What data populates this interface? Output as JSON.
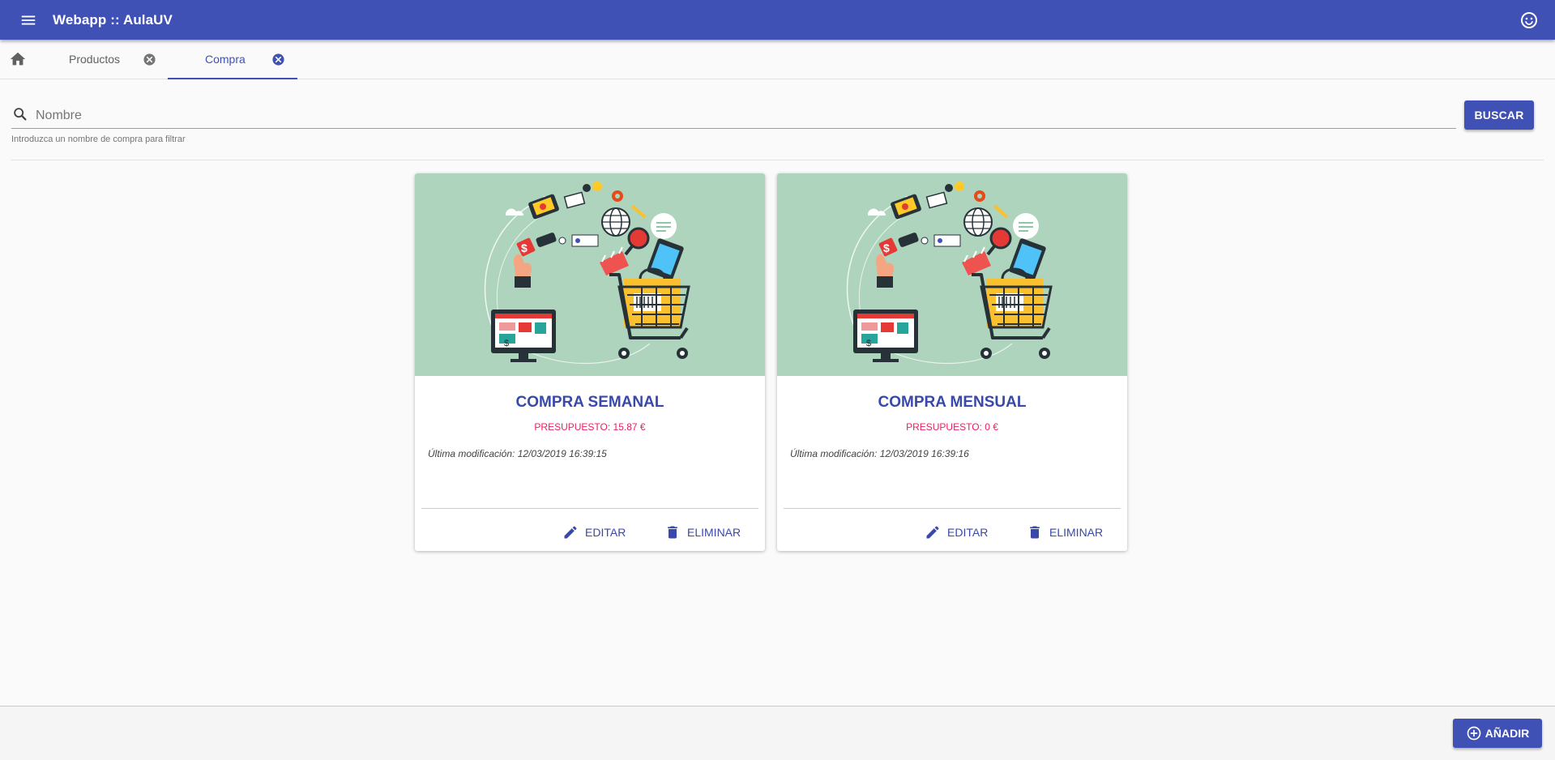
{
  "app": {
    "title": "Webapp :: AulaUV"
  },
  "tabs": [
    {
      "label": "Productos",
      "active": false
    },
    {
      "label": "Compra",
      "active": true
    }
  ],
  "search": {
    "placeholder": "Nombre",
    "value": "",
    "hint": "Introduzca un nombre de compra para filtrar",
    "button_label": "BUSCAR"
  },
  "cards": [
    {
      "title": "COMPRA SEMANAL",
      "budget": "PRESUPUESTO: 15.87 €",
      "modified": "Última modificación: 12/03/2019 16:39:15",
      "edit_label": "EDITAR",
      "delete_label": "ELIMINAR"
    },
    {
      "title": "COMPRA MENSUAL",
      "budget": "PRESUPUESTO: 0 €",
      "modified": "Última modificación: 12/03/2019 16:39:16",
      "edit_label": "EDITAR",
      "delete_label": "ELIMINAR"
    }
  ],
  "footer": {
    "add_label": "AÑADIR"
  },
  "colors": {
    "primary": "#3f51b5",
    "accent": "#e91e63",
    "card_media_bg": "#afd4bd"
  },
  "icons": {
    "menu": "menu-icon",
    "user": "smiley-icon",
    "home": "home-icon",
    "tab_close": "close-circle-icon",
    "search": "search-icon",
    "edit": "pencil-icon",
    "delete": "trash-icon",
    "add": "plus-circle-icon"
  }
}
